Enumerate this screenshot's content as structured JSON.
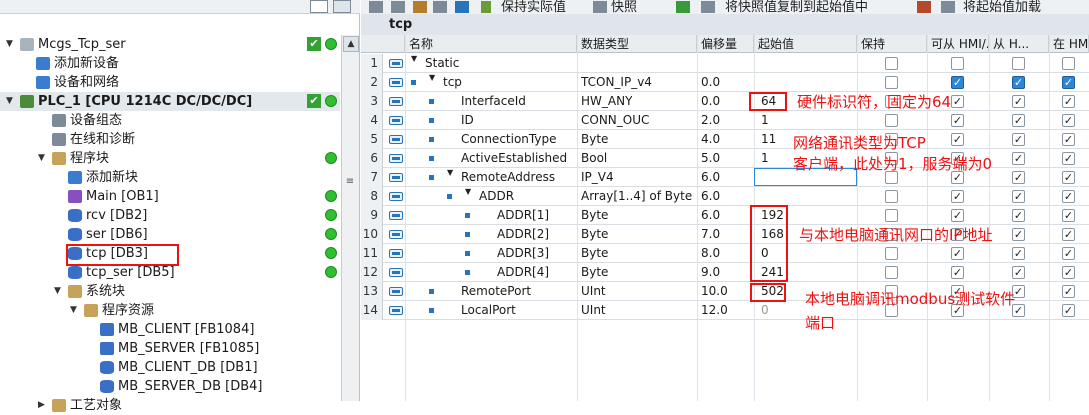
{
  "tree": {
    "items": [
      {
        "label": "Mcgs_Tcp_ser",
        "level": 0,
        "expand": "▼",
        "icon": "project-icon",
        "check": true,
        "dot": true
      },
      {
        "label": "添加新设备",
        "level": 1,
        "expand": "",
        "icon": "add-device-icon"
      },
      {
        "label": "设备和网络",
        "level": 1,
        "expand": "",
        "icon": "network-icon"
      },
      {
        "label": "PLC_1 [CPU 1214C DC/DC/DC]",
        "level": 0,
        "expand": "▼",
        "icon": "plc-icon",
        "check": true,
        "dot": true,
        "bold": true,
        "sel": true
      },
      {
        "label": "设备组态",
        "level": 2,
        "expand": "",
        "icon": "device-config-icon"
      },
      {
        "label": "在线和诊断",
        "level": 2,
        "expand": "",
        "icon": "diagnostics-icon"
      },
      {
        "label": "程序块",
        "level": 2,
        "expand": "▼",
        "icon": "folder-icon",
        "dot": true
      },
      {
        "label": "添加新块",
        "level": 3,
        "expand": "",
        "icon": "add-block-icon"
      },
      {
        "label": "Main [OB1]",
        "level": 3,
        "expand": "",
        "icon": "ob-icon",
        "dot": true
      },
      {
        "label": "rcv [DB2]",
        "level": 3,
        "expand": "",
        "icon": "db-icon",
        "dot": true
      },
      {
        "label": "ser [DB6]",
        "level": 3,
        "expand": "",
        "icon": "db-icon",
        "dot": true
      },
      {
        "label": "tcp [DB3]",
        "level": 3,
        "expand": "",
        "icon": "db-icon",
        "dot": true,
        "boxed": true
      },
      {
        "label": "tcp_ser [DB5]",
        "level": 3,
        "expand": "",
        "icon": "db-icon",
        "dot": true
      },
      {
        "label": "系统块",
        "level": 3,
        "expand": "▼",
        "icon": "folder-icon"
      },
      {
        "label": "程序资源",
        "level": 4,
        "expand": "▼",
        "icon": "folder-icon"
      },
      {
        "label": "MB_CLIENT [FB1084]",
        "level": 5,
        "expand": "",
        "icon": "fb-icon"
      },
      {
        "label": "MB_SERVER [FB1085]",
        "level": 5,
        "expand": "",
        "icon": "fb-icon"
      },
      {
        "label": "MB_CLIENT_DB [DB1]",
        "level": 5,
        "expand": "",
        "icon": "db-icon"
      },
      {
        "label": "MB_SERVER_DB [DB4]",
        "level": 5,
        "expand": "",
        "icon": "db-icon"
      },
      {
        "label": "工艺对象",
        "level": 2,
        "expand": "▶",
        "icon": "folder-icon"
      }
    ]
  },
  "toolbar": {
    "keep_actual": "保持实际值",
    "snapshot": "快照",
    "copy_snapshot": "将快照值复制到起始值中",
    "load_start": "将起始值加载"
  },
  "db_title": "tcp",
  "columns": [
    "名称",
    "数据类型",
    "偏移量",
    "起始值",
    "保持",
    "可从 HMI/...",
    "从 H...",
    "在 HMI..."
  ],
  "rows": [
    {
      "n": "1",
      "indent": 0,
      "expand": "▼",
      "name": "Static",
      "type": "",
      "offset": "",
      "start": "",
      "keep": false,
      "hmi1": false,
      "hmi2": false,
      "hmi3": false,
      "sq": false,
      "start_grey": false
    },
    {
      "n": "2",
      "indent": 1,
      "expand": "▼",
      "name": "tcp",
      "type": "TCON_IP_v4",
      "offset": "0.0",
      "start": "",
      "keep": false,
      "hmi1": true,
      "hmi2": true,
      "hmi3": true,
      "blue": true,
      "sq": true
    },
    {
      "n": "3",
      "indent": 2,
      "expand": "",
      "name": "InterfaceId",
      "type": "HW_ANY",
      "offset": "0.0",
      "start": "64",
      "keep": false,
      "hmi1": true,
      "hmi2": true,
      "hmi3": true,
      "sq": true
    },
    {
      "n": "4",
      "indent": 2,
      "expand": "",
      "name": "ID",
      "type": "CONN_OUC",
      "offset": "2.0",
      "start": "1",
      "keep": false,
      "hmi1": true,
      "hmi2": true,
      "hmi3": true,
      "sq": true
    },
    {
      "n": "5",
      "indent": 2,
      "expand": "",
      "name": "ConnectionType",
      "type": "Byte",
      "offset": "4.0",
      "start": "11",
      "keep": false,
      "hmi1": true,
      "hmi2": true,
      "hmi3": true,
      "sq": true
    },
    {
      "n": "6",
      "indent": 2,
      "expand": "",
      "name": "ActiveEstablished",
      "type": "Bool",
      "offset": "5.0",
      "start": "1",
      "keep": false,
      "hmi1": true,
      "hmi2": true,
      "hmi3": true,
      "sq": true
    },
    {
      "n": "7",
      "indent": 2,
      "expand": "▼",
      "name": "RemoteAddress",
      "type": "IP_V4",
      "offset": "6.0",
      "start": "",
      "keep": false,
      "hmi1": true,
      "hmi2": true,
      "hmi3": true,
      "sq": true,
      "selected": true
    },
    {
      "n": "8",
      "indent": 3,
      "expand": "▼",
      "name": "ADDR",
      "type": "Array[1..4] of Byte",
      "offset": "6.0",
      "start": "",
      "keep": false,
      "hmi1": true,
      "hmi2": true,
      "hmi3": true,
      "sq": true
    },
    {
      "n": "9",
      "indent": 4,
      "expand": "",
      "name": "ADDR[1]",
      "type": "Byte",
      "offset": "6.0",
      "start": "192",
      "keep": false,
      "hmi1": true,
      "hmi2": true,
      "hmi3": true,
      "sq": true
    },
    {
      "n": "10",
      "indent": 4,
      "expand": "",
      "name": "ADDR[2]",
      "type": "Byte",
      "offset": "7.0",
      "start": "168",
      "keep": false,
      "hmi1": true,
      "hmi2": true,
      "hmi3": true,
      "sq": true
    },
    {
      "n": "11",
      "indent": 4,
      "expand": "",
      "name": "ADDR[3]",
      "type": "Byte",
      "offset": "8.0",
      "start": "0",
      "keep": false,
      "hmi1": true,
      "hmi2": true,
      "hmi3": true,
      "sq": true
    },
    {
      "n": "12",
      "indent": 4,
      "expand": "",
      "name": "ADDR[4]",
      "type": "Byte",
      "offset": "9.0",
      "start": "241",
      "keep": false,
      "hmi1": true,
      "hmi2": true,
      "hmi3": true,
      "sq": true
    },
    {
      "n": "13",
      "indent": 2,
      "expand": "",
      "name": "RemotePort",
      "type": "UInt",
      "offset": "10.0",
      "start": "502",
      "keep": false,
      "hmi1": true,
      "hmi2": true,
      "hmi3": true,
      "sq": true
    },
    {
      "n": "14",
      "indent": 2,
      "expand": "",
      "name": "LocalPort",
      "type": "UInt",
      "offset": "12.0",
      "start": "0",
      "keep": false,
      "hmi1": true,
      "hmi2": true,
      "hmi3": true,
      "sq": true,
      "start_grey": true
    }
  ],
  "annotations": {
    "a1": "硬件标识符，固定为64",
    "a2": "网络通讯类型为TCP",
    "a3": "客户端，此处为1，服务端为0",
    "a4": "与本地电脑通讯网口的IP地址",
    "a5": "本地电脑调讯modbus测试软件",
    "a6": "端口"
  },
  "colors": {
    "annotation_red": "#ee1111",
    "status_green": "#2fbf2f",
    "selected_tree": "#e3e8ec",
    "hmi_checkbox_blue": "#2d87d6"
  }
}
